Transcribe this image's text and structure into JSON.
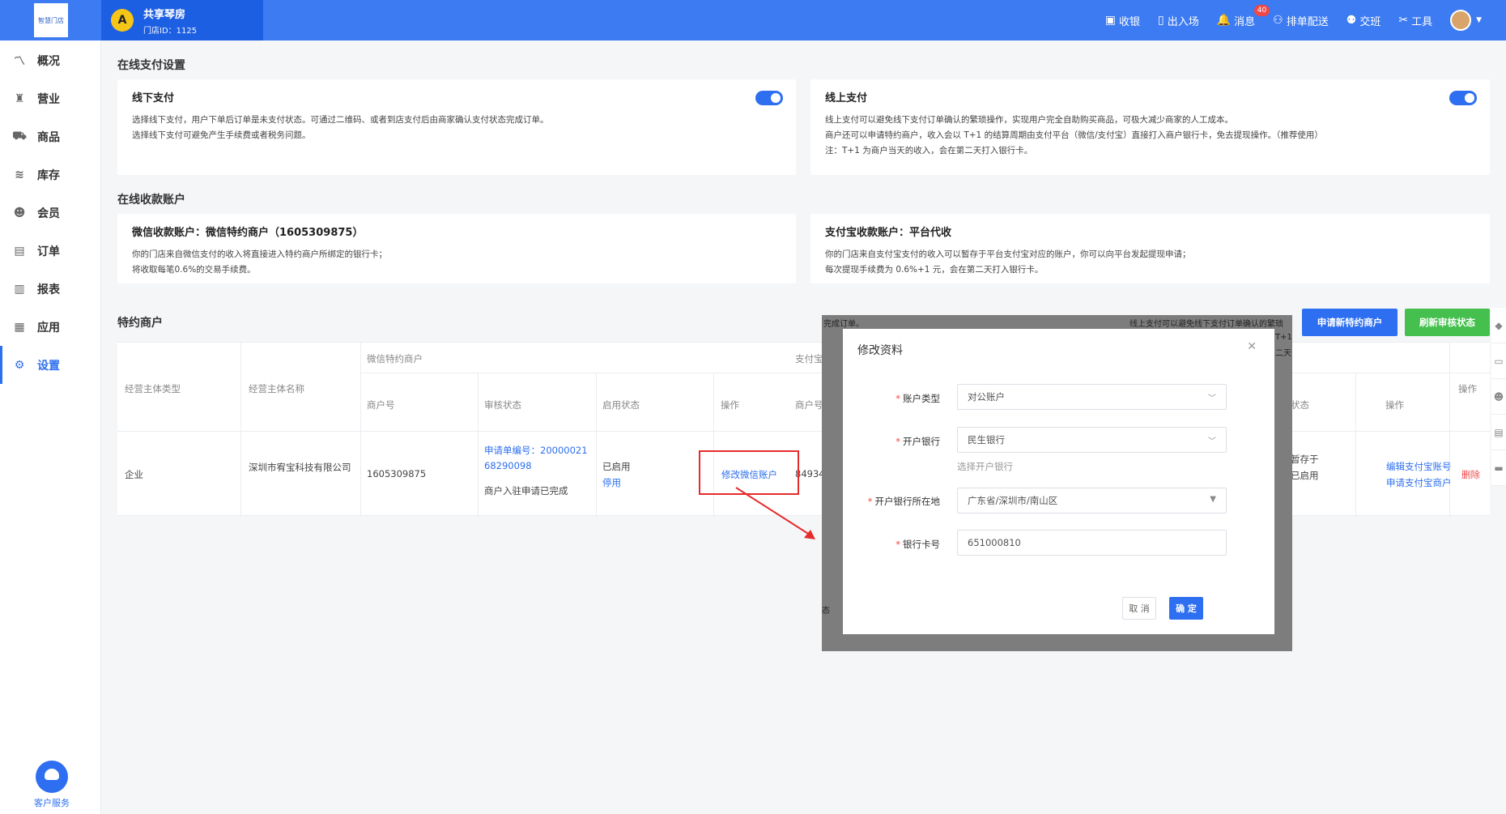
{
  "topbar": {
    "logo_text": "智慧门店",
    "store_avatar": "A",
    "store_name": "共享琴房",
    "store_id": "门店ID：1125",
    "nav": [
      {
        "icon": "cashier-icon",
        "glyph": "▣",
        "label": "收银"
      },
      {
        "icon": "entry-icon",
        "glyph": "▯",
        "label": "出入场"
      },
      {
        "icon": "bell-icon",
        "glyph": "🔔",
        "label": "消息",
        "badge": "40"
      },
      {
        "icon": "dispatch-icon",
        "glyph": "⚇",
        "label": "排单配送"
      },
      {
        "icon": "shift-icon",
        "glyph": "⚉",
        "label": "交班"
      },
      {
        "icon": "tools-icon",
        "glyph": "✂",
        "label": "工具"
      }
    ]
  },
  "sidebar": {
    "items": [
      {
        "icon": "overview-icon",
        "glyph": "〽",
        "label": "概况"
      },
      {
        "icon": "business-icon",
        "glyph": "♜",
        "label": "营业"
      },
      {
        "icon": "cart-icon",
        "glyph": "⛟",
        "label": "商品"
      },
      {
        "icon": "inventory-icon",
        "glyph": "≋",
        "label": "库存"
      },
      {
        "icon": "member-icon",
        "glyph": "☻",
        "label": "会员"
      },
      {
        "icon": "order-icon",
        "glyph": "▤",
        "label": "订单"
      },
      {
        "icon": "report-icon",
        "glyph": "▥",
        "label": "报表"
      },
      {
        "icon": "apps-icon",
        "glyph": "▦",
        "label": "应用"
      },
      {
        "icon": "settings-icon",
        "glyph": "⚙",
        "label": "设置"
      }
    ],
    "service_label": "客户服务"
  },
  "online_payment": {
    "title": "在线支付设置",
    "offline": {
      "title": "线下支付",
      "lines": [
        "选择线下支付，用户下单后订单是未支付状态。可通过二维码、或者到店支付后由商家确认支付状态完成订单。",
        "选择线下支付可避免产生手续费或者税务问题。"
      ]
    },
    "online": {
      "title": "线上支付",
      "lines": [
        "线上支付可以避免线下支付订单确认的繁琐操作，实现用户完全自助购买商品，可极大减少商家的人工成本。",
        "商户还可以申请特约商户，收入会以 T+1 的结算周期由支付平台（微信/支付宝）直接打入商户银行卡，免去提现操作。（推荐使用）",
        "注：T+1 为商户当天的收入，会在第二天打入银行卡。"
      ]
    }
  },
  "accounts": {
    "title": "在线收款账户",
    "wechat": {
      "title": "微信收款账户：微信特约商户（1605309875）",
      "lines": [
        "你的门店来自微信支付的收入将直接进入特约商户所绑定的银行卡；",
        "将收取每笔0.6%的交易手续费。"
      ]
    },
    "alipay": {
      "title": "支付宝收款账户：平台代收",
      "lines": [
        "你的门店来自支付宝支付的收入可以暂存于平台支付宝对应的账户，你可以向平台发起提现申请；",
        "每次提现手续费为 0.6%+1 元，会在第二天打入银行卡。"
      ]
    }
  },
  "merchant": {
    "title": "特约商户",
    "apply_button": "申请新特约商户",
    "refresh_button": "刷新审核状态",
    "headers": {
      "type": "经营主体类型",
      "name": "经营主体名称",
      "wechat_group": "微信特约商户",
      "merchant_no": "商户号",
      "audit": "审核状态",
      "enable": "启用状态",
      "op": "操作",
      "alipay_group": "支付宝",
      "alipay_merchant_no": "商户号",
      "alipay_status": "状态",
      "alipay_op": "操作",
      "op2": "操作"
    },
    "row": {
      "type": "企业",
      "name": "深圳市宥宝科技有限公司",
      "merchant_no": "1605309875",
      "audit_link": "申请单编号：2000002168290098",
      "audit_status": "商户入驻申请已完成",
      "enable_status": "已启用",
      "disable_link": "停用",
      "edit_link": "修改微信账户",
      "alipay_merchant_no": "84934",
      "alipay_status_partial": "暂存于",
      "alipay_status_partial2": "已启用",
      "alipay_edit": "编辑支付宝账号",
      "alipay_apply": "申请支付宝商户",
      "delete": "删除"
    }
  },
  "background_ghost": {
    "t1": "完成订单。",
    "t2": "线上支付可以避免线下支付订单确认的繁琐",
    "t3": "T+1",
    "t4": "二天",
    "t5": "态"
  },
  "modal": {
    "title": "修改资料",
    "fields": {
      "account_type_label": "账户类型",
      "account_type_value": "对公账户",
      "bank_label": "开户银行",
      "bank_value": "民生银行",
      "bank_hint": "选择开户银行",
      "region_label": "开户银行所在地",
      "region_value": "广东省/深圳市/南山区",
      "card_label": "银行卡号",
      "card_value": "651000810"
    },
    "cancel": "取 消",
    "confirm": "确 定"
  },
  "colors": {
    "primary": "#3c7bf2",
    "accent": "#2d6ff0",
    "green": "#45c04e",
    "danger": "#f04747",
    "annotation_red": "#e52b2b"
  }
}
